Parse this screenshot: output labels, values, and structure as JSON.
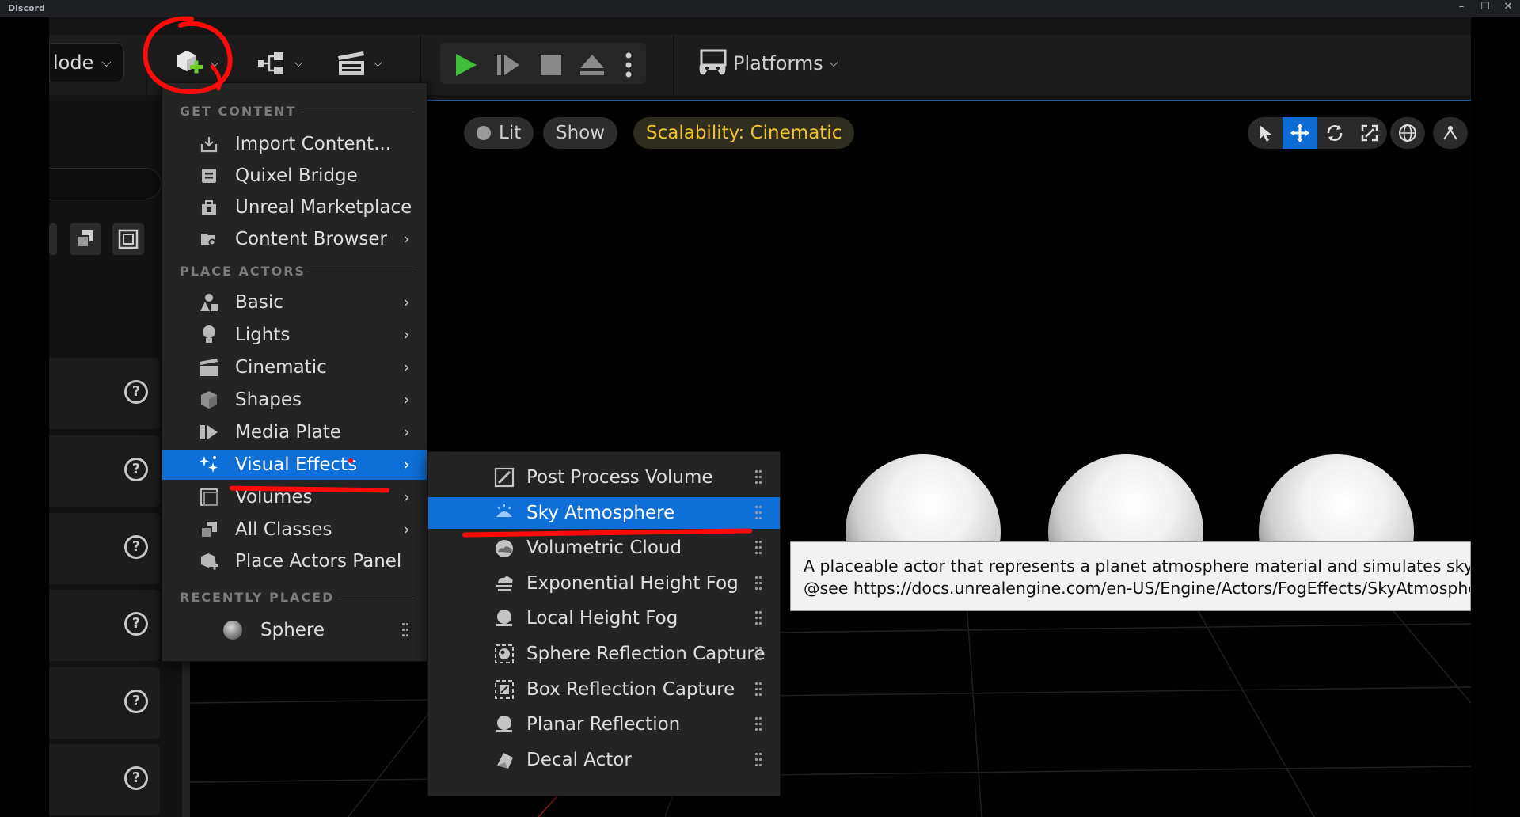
{
  "window": {
    "app_title": "Discord",
    "minimize": "–",
    "maximize": "☐",
    "close": "✕"
  },
  "toolbar": {
    "mode_label": "lode",
    "platforms_label": "Platforms"
  },
  "viewport": {
    "lit_label": "Lit",
    "show_label": "Show",
    "scalability_label": "Scalability: Cinematic"
  },
  "main_menu": {
    "sections": {
      "get_content": "GET CONTENT",
      "place_actors": "PLACE ACTORS",
      "recently_placed": "RECENTLY PLACED"
    },
    "get_content_items": [
      {
        "label": "Import Content...",
        "icon": "import-icon"
      },
      {
        "label": "Quixel Bridge",
        "icon": "bridge-icon"
      },
      {
        "label": "Unreal Marketplace",
        "icon": "marketplace-icon"
      },
      {
        "label": "Content Browser",
        "icon": "folder-icon"
      }
    ],
    "place_actors_items": [
      {
        "label": "Basic",
        "icon": "basic-icon"
      },
      {
        "label": "Lights",
        "icon": "bulb-icon"
      },
      {
        "label": "Cinematic",
        "icon": "clapper-icon"
      },
      {
        "label": "Shapes",
        "icon": "cube-icon"
      },
      {
        "label": "Media Plate",
        "icon": "media-icon"
      },
      {
        "label": "Visual Effects",
        "icon": "sparkle-icon"
      },
      {
        "label": "Volumes",
        "icon": "volume-icon"
      },
      {
        "label": "All Classes",
        "icon": "classes-icon"
      },
      {
        "label": "Place Actors Panel",
        "icon": "place-actor-icon"
      }
    ],
    "recently_placed_items": [
      {
        "label": "Sphere",
        "icon": "sphere-icon"
      }
    ],
    "highlighted": "Visual Effects"
  },
  "submenu": {
    "items": [
      {
        "label": "Post Process Volume",
        "icon": "post-process-icon"
      },
      {
        "label": "Sky Atmosphere",
        "icon": "sky-icon"
      },
      {
        "label": "Volumetric Cloud",
        "icon": "cloud-icon"
      },
      {
        "label": "Exponential Height Fog",
        "icon": "fog-icon"
      },
      {
        "label": "Local Height Fog",
        "icon": "local-fog-icon"
      },
      {
        "label": "Sphere Reflection Capture",
        "icon": "sphere-capture-icon"
      },
      {
        "label": "Box Reflection Capture",
        "icon": "box-capture-icon"
      },
      {
        "label": "Planar Reflection",
        "icon": "planar-icon"
      },
      {
        "label": "Decal Actor",
        "icon": "decal-icon"
      }
    ],
    "highlighted": "Sky Atmosphere"
  },
  "tooltip": {
    "line1": "A placeable actor that represents a planet atmosphere material and simulates sky and light scattering in the atmosphere.",
    "line2": "@see https://docs.unrealengine.com/en-US/Engine/Actors/FogEffects/SkyAtmosphere/index.html"
  },
  "left_panel": {
    "help_glyph": "?"
  },
  "colors": {
    "highlight": "#0e6fd8",
    "play_green": "#3fbf3a",
    "scalability_yellow": "#f1c232",
    "annotation_red": "#ff0a0a",
    "menu_bg": "#242424"
  }
}
